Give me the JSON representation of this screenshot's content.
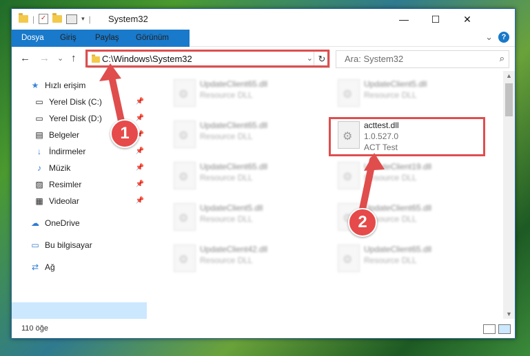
{
  "window": {
    "title": "System32",
    "minimize_glyph": "—",
    "maximize_glyph": "☐",
    "close_glyph": "✕"
  },
  "ribbon": {
    "tabs": [
      "Dosya",
      "Giriş",
      "Paylaş",
      "Görünüm"
    ],
    "expand_glyph": "⌄",
    "help_glyph": "?"
  },
  "nav": {
    "back": "←",
    "forward": "→",
    "recent": "⌄",
    "up": "↑"
  },
  "address": {
    "path": "C:\\Windows\\System32",
    "dropdown_glyph": "⌄",
    "refresh_glyph": "↻"
  },
  "search": {
    "placeholder": "Ara: System32",
    "icon": "⌕"
  },
  "sidebar": {
    "quick_access": "Hızlı erişim",
    "items": [
      {
        "label": "Yerel Disk (C:)",
        "icon": "drive-icon",
        "glyph": "▭"
      },
      {
        "label": "Yerel Disk (D:)",
        "icon": "drive-icon",
        "glyph": "▭"
      },
      {
        "label": "Belgeler",
        "icon": "documents-icon",
        "glyph": "▤"
      },
      {
        "label": "İndirmeler",
        "icon": "downloads-icon",
        "glyph": "↓"
      },
      {
        "label": "Müzik",
        "icon": "music-icon",
        "glyph": "♪"
      },
      {
        "label": "Resimler",
        "icon": "pictures-icon",
        "glyph": "▨"
      },
      {
        "label": "Videolar",
        "icon": "videos-icon",
        "glyph": "▦"
      }
    ],
    "onedrive": "OneDrive",
    "this_pc": "Bu bilgisayar",
    "network": "Ağ",
    "pin_glyph": "📌"
  },
  "files": [
    {
      "name": "UpdateClient65.dll",
      "desc": "Resource DLL"
    },
    {
      "name": "UpdateClient5.dll",
      "desc": "Resource DLL"
    },
    {
      "name": "UpdateClient65.dll",
      "desc": "Resource DLL"
    },
    {
      "name": "acttest.dll",
      "desc": "1.0.527.0",
      "desc2": "ACT Test"
    },
    {
      "name": "UpdateClient65.dll",
      "desc": "Resource DLL"
    },
    {
      "name": "UpdateClient19.dll",
      "desc": "Resource DLL"
    },
    {
      "name": "UpdateClient5.dll",
      "desc": "Resource DLL"
    },
    {
      "name": "UpdateClient65.dll",
      "desc": "Resource DLL"
    },
    {
      "name": "UpdateClient42.dll",
      "desc": "Resource DLL"
    },
    {
      "name": "UpdateClient65.dll",
      "desc": "Resource DLL"
    }
  ],
  "status": {
    "count": "110 öğe"
  },
  "annotations": {
    "step1": "1",
    "step2": "2",
    "color": "#e04d4d"
  },
  "colors": {
    "accent": "#1979ca",
    "selection": "#cce8ff"
  }
}
